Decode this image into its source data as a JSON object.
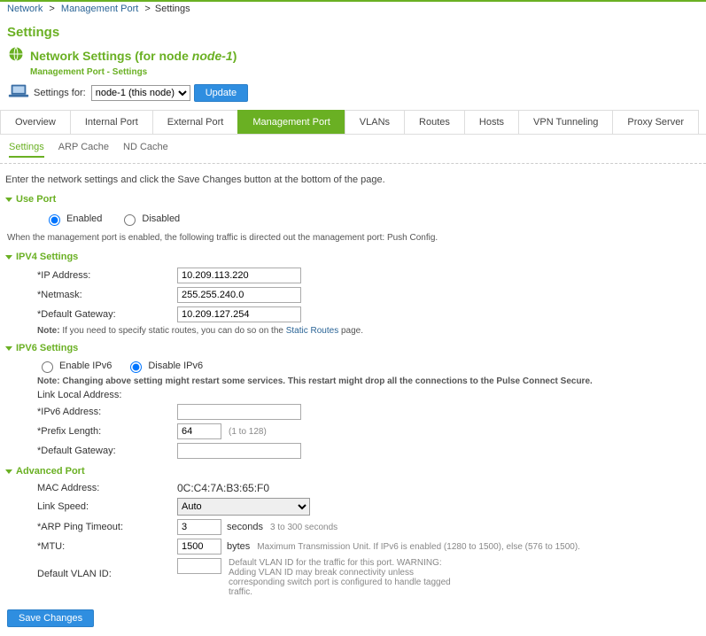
{
  "breadcrumb": {
    "a": "Network",
    "b": "Management Port",
    "c": "Settings",
    "sep": ">"
  },
  "pageTitle": "Settings",
  "netTitle_prefix": "Network Settings (for node ",
  "netTitle_node": "node-1",
  "netTitle_suffix": ")",
  "subBreadcrumb": "Management Port - Settings",
  "settingsFor": {
    "label": "Settings for:",
    "selected": "node-1 (this node)",
    "options": [
      "node-1 (this node)"
    ]
  },
  "updateBtn": "Update",
  "tabs": {
    "overview": "Overview",
    "internal": "Internal Port",
    "external": "External Port",
    "management": "Management Port",
    "vlans": "VLANs",
    "routes": "Routes",
    "hosts": "Hosts",
    "vpn": "VPN Tunneling",
    "proxy": "Proxy Server"
  },
  "subtabs": {
    "settings": "Settings",
    "arp": "ARP Cache",
    "nd": "ND Cache"
  },
  "instruction": "Enter the network settings and click the Save Changes button at the bottom of the page.",
  "sections": {
    "usePort": "Use Port",
    "ipv4": "IPV4 Settings",
    "ipv6": "IPV6 Settings",
    "adv": "Advanced Port"
  },
  "usePort": {
    "enabled": "Enabled",
    "disabled": "Disabled"
  },
  "mgmtHelp": "When the management port is enabled, the following traffic is directed out the management port: Push Config.",
  "ipv4": {
    "ipLabel": "*IP Address:",
    "ipValue": "10.209.113.220",
    "netmaskLabel": "*Netmask:",
    "netmaskValue": "255.255.240.0",
    "gwLabel": "*Default Gateway:",
    "gwValue": "10.209.127.254",
    "noteBold": "Note:",
    "noteText": " If you need to specify static routes, you can do so on the ",
    "staticRoutesLink": "Static Routes",
    "notePage": " page."
  },
  "ipv6": {
    "enableLabel": "Enable IPv6",
    "disableLabel": "Disable IPv6",
    "warnBold": "Note: Changing above setting might restart some services. This restart might drop all the connections to the Pulse Connect Secure.",
    "llLabel": "Link Local Address:",
    "addrLabel": "*IPv6 Address:",
    "addrValue": "",
    "prefixLabel": "*Prefix Length:",
    "prefixValue": "64",
    "prefixHint": "(1 to 128)",
    "gwLabel": "*Default Gateway:",
    "gwValue": ""
  },
  "adv": {
    "macLabel": "MAC Address:",
    "macValue": "0C:C4:7A:B3:65:F0",
    "speedLabel": "Link Speed:",
    "speedSelected": "Auto",
    "speedOptions": [
      "Auto"
    ],
    "arpLabel": "*ARP Ping Timeout:",
    "arpValue": "3",
    "arpUnit": "seconds",
    "arpHint": "3 to 300 seconds",
    "mtuLabel": "*MTU:",
    "mtuValue": "1500",
    "mtuUnit": "bytes",
    "mtuHint": "Maximum Transmission Unit. If IPv6 is enabled (1280 to 1500), else (576 to 1500).",
    "vlanLabel": "Default VLAN ID:",
    "vlanValue": "",
    "vlanHint": "Default VLAN ID for the traffic for this port.\nWARNING: Adding VLAN ID may break connectivity unless corresponding switch port is configured to handle tagged traffic."
  },
  "saveBtn": "Save Changes"
}
